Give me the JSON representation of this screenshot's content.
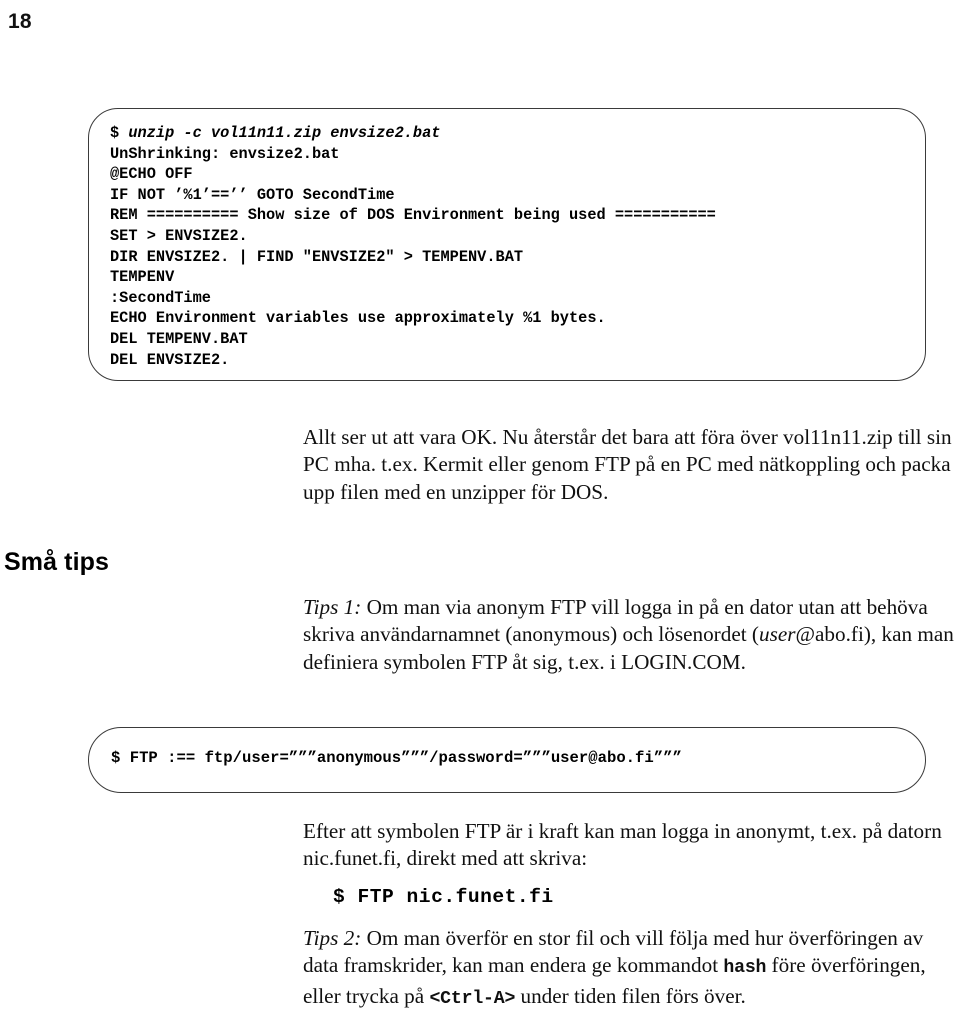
{
  "page": {
    "number": "18"
  },
  "code_block_1": {
    "lines": [
      {
        "prompt": "$ ",
        "italic": "unzip -c vol11n11.zip envsize2.bat"
      },
      {
        "text": "UnShrinking: envsize2.bat"
      },
      {
        "text": "@ECHO OFF"
      },
      {
        "text": "IF NOT ’%1’==’’ GOTO SecondTime"
      },
      {
        "text": "REM ========== Show size of DOS Environment being used ==========="
      },
      {
        "text": "SET > ENVSIZE2."
      },
      {
        "text": "DIR ENVSIZE2. | FIND \"ENVSIZE2\" > TEMPENV.BAT"
      },
      {
        "text": "TEMPENV"
      },
      {
        "text": ":SecondTime"
      },
      {
        "text": "ECHO Environment variables use approximately %1 bytes."
      },
      {
        "text": "DEL TEMPENV.BAT"
      },
      {
        "text": "DEL ENVSIZE2."
      }
    ]
  },
  "code_block_2": {
    "line": "$ FTP :== ftp/user=”””anonymous”””/password=”””user@abo.fi”””"
  },
  "section_heading": "Små tips",
  "paragraphs": {
    "intro": "Allt ser ut att vara OK. Nu återstår det bara att föra över vol11n11.zip till sin PC mha. t.ex. Kermit eller genom FTP på en PC med nätkoppling och packa upp filen med en unzipper för DOS.",
    "tips1_label": "Tips 1:",
    "tips1_part1": " Om man via anonym FTP vill logga in på en dator utan att behöva skriva användarnamnet (anonymous) och lösenordet (",
    "tips1_user": "user",
    "tips1_part2": "@abo.fi), kan man definiera symbolen FTP åt sig, t.ex. i LOGIN.COM.",
    "after": "Efter att symbolen FTP är i kraft kan man logga in anonymt, t.ex. på datorn nic.funet.fi, direkt med att skriva:",
    "tips2_label": "Tips 2:",
    "tips2_part1": " Om man överför en stor fil och vill följa med hur överföringen av data framskrider, kan man endera ge kommandot ",
    "tips2_mono1": "hash",
    "tips2_part2": " före överföringen, eller trycka på ",
    "tips2_mono2": "<Ctrl-A>",
    "tips2_part3": " under tiden filen förs över."
  },
  "inline_command": "$ FTP nic.funet.fi",
  "colors": {
    "text": "#101010",
    "box_border": "#3a3a3a",
    "background": "#ffffff"
  }
}
